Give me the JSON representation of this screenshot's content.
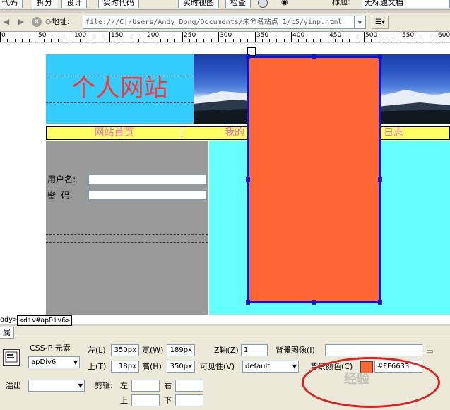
{
  "toolbar": {
    "code_label": "代码",
    "split_label": "拆分",
    "design_label": "设计",
    "live_code_label": "实时代码",
    "live_view_label": "实时视图",
    "inspect_label": "检查",
    "title_label": "标题:",
    "title_value": "无标题文档"
  },
  "address": {
    "label": "地址:",
    "value": "file:///C|/Users/Andy Dong/Documents/未命名站点 1/c5/yinp.html"
  },
  "ruler": {
    "labels": [
      "0",
      "50",
      "100",
      "150",
      "200",
      "250",
      "300",
      "350",
      "400",
      "450",
      "500",
      "550",
      "600"
    ]
  },
  "page": {
    "site_title": "个人网站",
    "nav_items": [
      "网站首页",
      "我的",
      "日志"
    ],
    "username_label": "用户名:",
    "password_label": "密  码:",
    "colors": {
      "header_bg": "#33ccff",
      "nav_bg": "#ffff66",
      "nav_text": "#ff66cc",
      "left_bg": "#999999",
      "right_bg": "#66ffff",
      "apdiv_bg": "#ff6633",
      "title_color": "#ff3333"
    }
  },
  "tagbar": {
    "tags": [
      "ody>",
      "<div#apDiv6>"
    ]
  },
  "properties": {
    "tab_label": "属性",
    "element_type": "CSS-P 元素",
    "element_id": "apDiv6",
    "left_label": "左(L)",
    "left_value": "350px",
    "top_label": "上(T)",
    "top_value": "18px",
    "width_label": "宽(W)",
    "width_value": "189px",
    "height_label": "高(H)",
    "height_value": "350px",
    "z_label": "Z轴(Z)",
    "z_value": "1",
    "visibility_label": "可见性(V)",
    "visibility_value": "default",
    "bg_image_label": "背景图像(I)",
    "bg_color_label": "背景颜色(C)",
    "bg_color_value": "#FF6633",
    "overflow_label": "溢出",
    "clip_label": "剪辑:",
    "clip_left_label": "左",
    "clip_right_label": "右",
    "clip_top_label": "上",
    "clip_bottom_label": "下"
  },
  "watermark": "经验"
}
